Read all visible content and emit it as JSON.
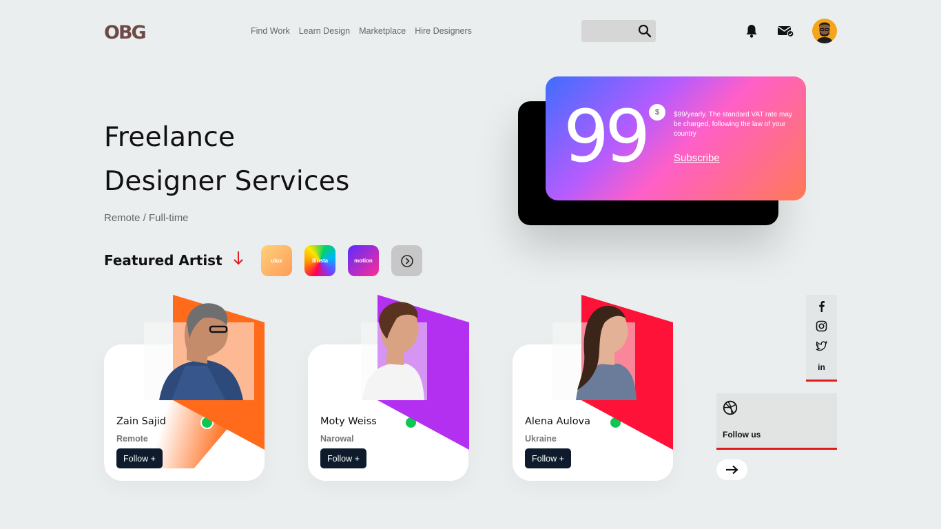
{
  "header": {
    "logo": "OBG",
    "nav": [
      "Find Work",
      "Learn Design",
      "Marketplace",
      "Hire Designers"
    ]
  },
  "hero": {
    "title_line1": "Freelance",
    "title_line2": "Designer Services",
    "subtitle": "Remote / Full-time",
    "featured_label": "Featured Artist",
    "tags": [
      "ulux",
      "Illusta",
      "motion"
    ]
  },
  "pricing": {
    "price": "99",
    "currency": "$",
    "description": "$99/yearly. The standard VAT rate may be charged, following the law of your country",
    "subscribe": "Subscribe"
  },
  "artists": [
    {
      "name": "Zain Sajid",
      "location": "Remote",
      "follow": "Follow +",
      "accent": "#ff6b1a"
    },
    {
      "name": "Moty Weiss",
      "location": "Narowal",
      "follow": "Follow +",
      "accent": "#b330f0"
    },
    {
      "name": "Alena Aulova",
      "location": "Ukraine",
      "follow": "Follow +",
      "accent": "#ff1238"
    }
  ],
  "social": {
    "icons": [
      "facebook-icon",
      "instagram-icon",
      "twitter-icon",
      "linkedin-icon"
    ],
    "linkedin_text": "in",
    "follow_us": "Follow us"
  },
  "colors": {
    "background": "#eaeeee",
    "accent_red": "#e01b1b",
    "status_online": "#10c653",
    "button_dark": "#0e1b2c"
  }
}
